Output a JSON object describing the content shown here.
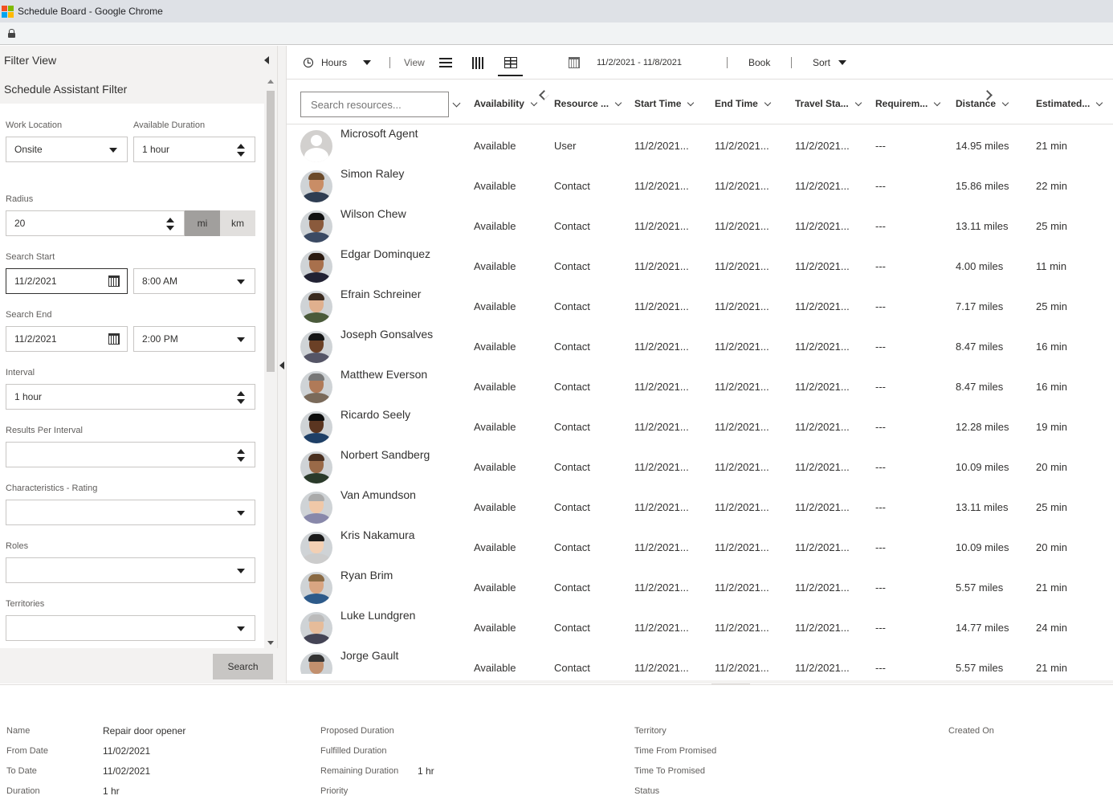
{
  "window": {
    "title": "Schedule Board - Google Chrome"
  },
  "colors": {
    "win_red": "#f25022",
    "win_green": "#7fba00",
    "win_blue": "#00a4ef",
    "win_yellow": "#ffb900"
  },
  "left_panel": {
    "filter_view": "Filter View",
    "assistant_title": "Schedule Assistant Filter",
    "work_location": {
      "label": "Work Location",
      "value": "Onsite"
    },
    "available_duration": {
      "label": "Available Duration",
      "value": "1 hour"
    },
    "radius": {
      "label": "Radius",
      "value": "20",
      "unit_mi": "mi",
      "unit_km": "km",
      "selected_unit": "mi"
    },
    "search_start": {
      "label": "Search Start",
      "date": "11/2/2021",
      "time": "8:00 AM"
    },
    "search_end": {
      "label": "Search End",
      "date": "11/2/2021",
      "time": "2:00 PM"
    },
    "interval": {
      "label": "Interval",
      "value": "1 hour"
    },
    "results_per_interval": {
      "label": "Results Per Interval",
      "value": ""
    },
    "characteristics": {
      "label": "Characteristics - Rating",
      "value": ""
    },
    "roles": {
      "label": "Roles",
      "value": ""
    },
    "territories": {
      "label": "Territories",
      "value": ""
    },
    "search_button": "Search"
  },
  "toolbar": {
    "hours": "Hours",
    "view": "View",
    "date_range": "11/2/2021 - 11/8/2021",
    "book": "Book",
    "sort": "Sort"
  },
  "grid": {
    "search_placeholder": "Search resources...",
    "columns": [
      "Availability",
      "Resource ...",
      "Start Time",
      "End Time",
      "Travel Sta...",
      "Requirem...",
      "Distance",
      "Estimated..."
    ],
    "rows": [
      {
        "name": "Microsoft Agent",
        "availability": "Available",
        "type": "User",
        "start": "11/2/2021...",
        "end": "11/2/2021...",
        "travel": "11/2/2021...",
        "req": "---",
        "distance": "14.95 miles",
        "est": "21 min"
      },
      {
        "name": "Simon Raley",
        "availability": "Available",
        "type": "Contact",
        "start": "11/2/2021...",
        "end": "11/2/2021...",
        "travel": "11/2/2021...",
        "req": "---",
        "distance": "15.86 miles",
        "est": "22 min"
      },
      {
        "name": "Wilson Chew",
        "availability": "Available",
        "type": "Contact",
        "start": "11/2/2021...",
        "end": "11/2/2021...",
        "travel": "11/2/2021...",
        "req": "---",
        "distance": "13.11 miles",
        "est": "25 min"
      },
      {
        "name": "Edgar Dominquez",
        "availability": "Available",
        "type": "Contact",
        "start": "11/2/2021...",
        "end": "11/2/2021...",
        "travel": "11/2/2021...",
        "req": "---",
        "distance": "4.00 miles",
        "est": "11 min"
      },
      {
        "name": "Efrain Schreiner",
        "availability": "Available",
        "type": "Contact",
        "start": "11/2/2021...",
        "end": "11/2/2021...",
        "travel": "11/2/2021...",
        "req": "---",
        "distance": "7.17 miles",
        "est": "25 min"
      },
      {
        "name": "Joseph Gonsalves",
        "availability": "Available",
        "type": "Contact",
        "start": "11/2/2021...",
        "end": "11/2/2021...",
        "travel": "11/2/2021...",
        "req": "---",
        "distance": "8.47 miles",
        "est": "16 min"
      },
      {
        "name": "Matthew Everson",
        "availability": "Available",
        "type": "Contact",
        "start": "11/2/2021...",
        "end": "11/2/2021...",
        "travel": "11/2/2021...",
        "req": "---",
        "distance": "8.47 miles",
        "est": "16 min"
      },
      {
        "name": "Ricardo Seely",
        "availability": "Available",
        "type": "Contact",
        "start": "11/2/2021...",
        "end": "11/2/2021...",
        "travel": "11/2/2021...",
        "req": "---",
        "distance": "12.28 miles",
        "est": "19 min"
      },
      {
        "name": "Norbert Sandberg",
        "availability": "Available",
        "type": "Contact",
        "start": "11/2/2021...",
        "end": "11/2/2021...",
        "travel": "11/2/2021...",
        "req": "---",
        "distance": "10.09 miles",
        "est": "20 min"
      },
      {
        "name": "Van Amundson",
        "availability": "Available",
        "type": "Contact",
        "start": "11/2/2021...",
        "end": "11/2/2021...",
        "travel": "11/2/2021...",
        "req": "---",
        "distance": "13.11 miles",
        "est": "25 min"
      },
      {
        "name": "Kris Nakamura",
        "availability": "Available",
        "type": "Contact",
        "start": "11/2/2021...",
        "end": "11/2/2021...",
        "travel": "11/2/2021...",
        "req": "---",
        "distance": "10.09 miles",
        "est": "20 min"
      },
      {
        "name": "Ryan Brim",
        "availability": "Available",
        "type": "Contact",
        "start": "11/2/2021...",
        "end": "11/2/2021...",
        "travel": "11/2/2021...",
        "req": "---",
        "distance": "5.57 miles",
        "est": "21 min"
      },
      {
        "name": "Luke Lundgren",
        "availability": "Available",
        "type": "Contact",
        "start": "11/2/2021...",
        "end": "11/2/2021...",
        "travel": "11/2/2021...",
        "req": "---",
        "distance": "14.77 miles",
        "est": "24 min"
      },
      {
        "name": "Jorge Gault",
        "availability": "Available",
        "type": "Contact",
        "start": "11/2/2021...",
        "end": "11/2/2021...",
        "travel": "11/2/2021...",
        "req": "---",
        "distance": "5.57 miles",
        "est": "21 min"
      }
    ]
  },
  "details": {
    "name_label": "Name",
    "name_value": "Repair door opener",
    "from_label": "From Date",
    "from_value": "11/02/2021",
    "to_label": "To Date",
    "to_value": "11/02/2021",
    "duration_label": "Duration",
    "duration_value": "1 hr",
    "proposed_label": "Proposed Duration",
    "fulfilled_label": "Fulfilled Duration",
    "remaining_label": "Remaining Duration",
    "remaining_value": "1 hr",
    "priority_label": "Priority",
    "territory_label": "Territory",
    "time_from_label": "Time From Promised",
    "time_to_label": "Time To Promised",
    "status_label": "Status",
    "created_label": "Created On"
  }
}
